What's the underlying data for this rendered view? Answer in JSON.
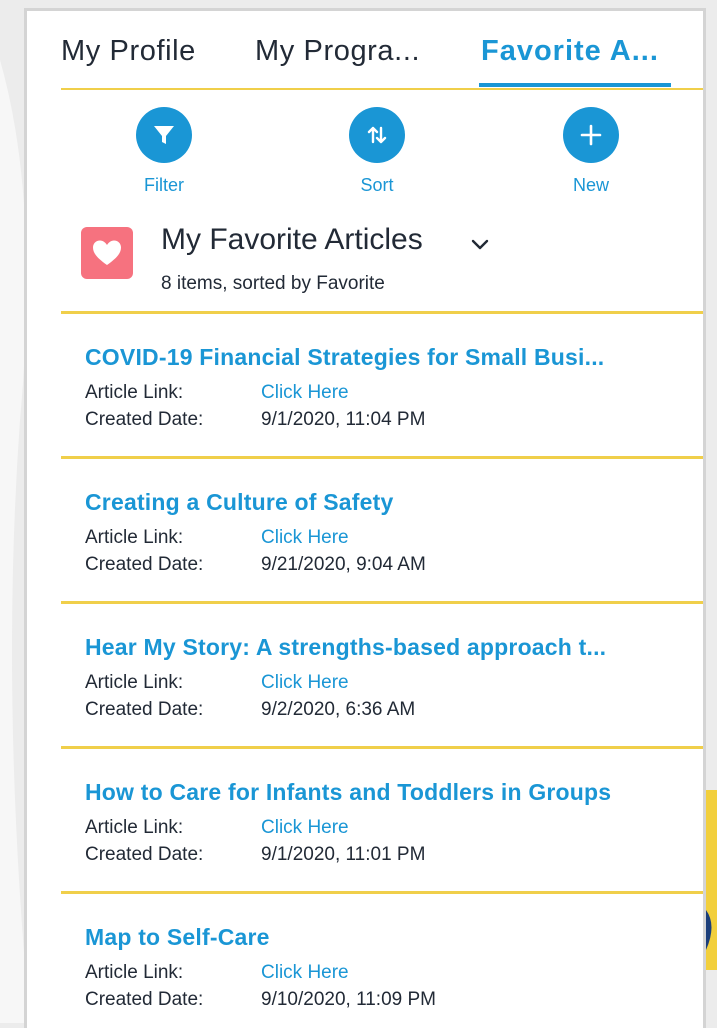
{
  "tabs": [
    {
      "label": "My Profile",
      "active": false
    },
    {
      "label": "My Progra...",
      "active": false
    },
    {
      "label": "Favorite A...",
      "active": true
    }
  ],
  "actions": {
    "filter": {
      "label": "Filter",
      "icon": "filter-icon"
    },
    "sort": {
      "label": "Sort",
      "icon": "sort-icon"
    },
    "new": {
      "label": "New",
      "icon": "plus-icon"
    }
  },
  "list_view": {
    "icon": "heart-icon",
    "title": "My Favorite Articles",
    "subtitle": "8 items, sorted by Favorite"
  },
  "field_labels": {
    "link": "Article Link:",
    "date": "Created Date:"
  },
  "articles": [
    {
      "title": "COVID-19 Financial Strategies for Small Busi...",
      "link_text": "Click Here",
      "created": "9/1/2020, 11:04 PM"
    },
    {
      "title": "Creating a Culture of Safety",
      "link_text": "Click Here",
      "created": "9/21/2020, 9:04 AM"
    },
    {
      "title": "Hear My Story: A strengths-based approach t...",
      "link_text": "Click Here",
      "created": "9/2/2020, 6:36 AM"
    },
    {
      "title": "How to Care for Infants and Toddlers in Groups",
      "link_text": "Click Here",
      "created": "9/1/2020, 11:01 PM"
    },
    {
      "title": "Map to Self-Care",
      "link_text": "Click Here",
      "created": "9/10/2020, 11:09 PM"
    }
  ],
  "colors": {
    "accent": "#1a96d5",
    "divider": "#f0cf4a",
    "heart_tile": "#f6727f",
    "text": "#222a36"
  }
}
